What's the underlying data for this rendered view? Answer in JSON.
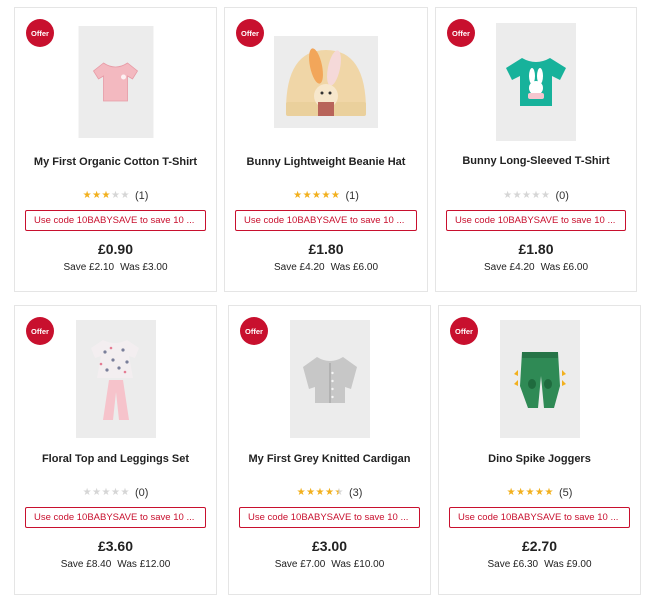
{
  "products": [
    {
      "badge": "Offer",
      "title": "My First Organic Cotton T-Shirt",
      "rating": 3,
      "review_count": "(1)",
      "promo": "Use code 10BABYSAVE to save 10 ...",
      "price": "£0.90",
      "save": "Save £2.10",
      "was": "Was £3.00",
      "icon": "pink-tshirt-icon"
    },
    {
      "badge": "Offer",
      "title": "Bunny Lightweight Beanie Hat",
      "rating": 5,
      "review_count": "(1)",
      "promo": "Use code 10BABYSAVE to save 10 ...",
      "price": "£1.80",
      "save": "Save £4.20",
      "was": "Was £6.00",
      "icon": "bunny-beanie-hat-icon"
    },
    {
      "badge": "Offer",
      "title": "Bunny Long-Sleeved T-Shirt",
      "rating": 0,
      "review_count": "(0)",
      "promo": "Use code 10BABYSAVE to save 10 ...",
      "price": "£1.80",
      "save": "Save £4.20",
      "was": "Was £6.00",
      "icon": "teal-bunny-tshirt-icon"
    },
    {
      "badge": "Offer",
      "title": "Floral Top and Leggings Set",
      "rating": 0,
      "review_count": "(0)",
      "promo": "Use code 10BABYSAVE to save 10 ...",
      "price": "£3.60",
      "save": "Save £8.40",
      "was": "Was £12.00",
      "icon": "floral-outfit-icon"
    },
    {
      "badge": "Offer",
      "title": "My First Grey Knitted Cardigan",
      "rating": 4.5,
      "review_count": "(3)",
      "promo": "Use code 10BABYSAVE to save 10 ...",
      "price": "£3.00",
      "save": "Save £7.00",
      "was": "Was £10.00",
      "icon": "grey-cardigan-icon"
    },
    {
      "badge": "Offer",
      "title": "Dino Spike Joggers",
      "rating": 5,
      "review_count": "(5)",
      "promo": "Use code 10BABYSAVE to save 10 ...",
      "price": "£2.70",
      "save": "Save £6.30",
      "was": "Was £9.00",
      "icon": "green-dino-joggers-icon"
    }
  ],
  "colors": {
    "offer_red": "#c8102e",
    "star_gold": "#f2b01e",
    "star_empty": "#d6d6d6"
  }
}
